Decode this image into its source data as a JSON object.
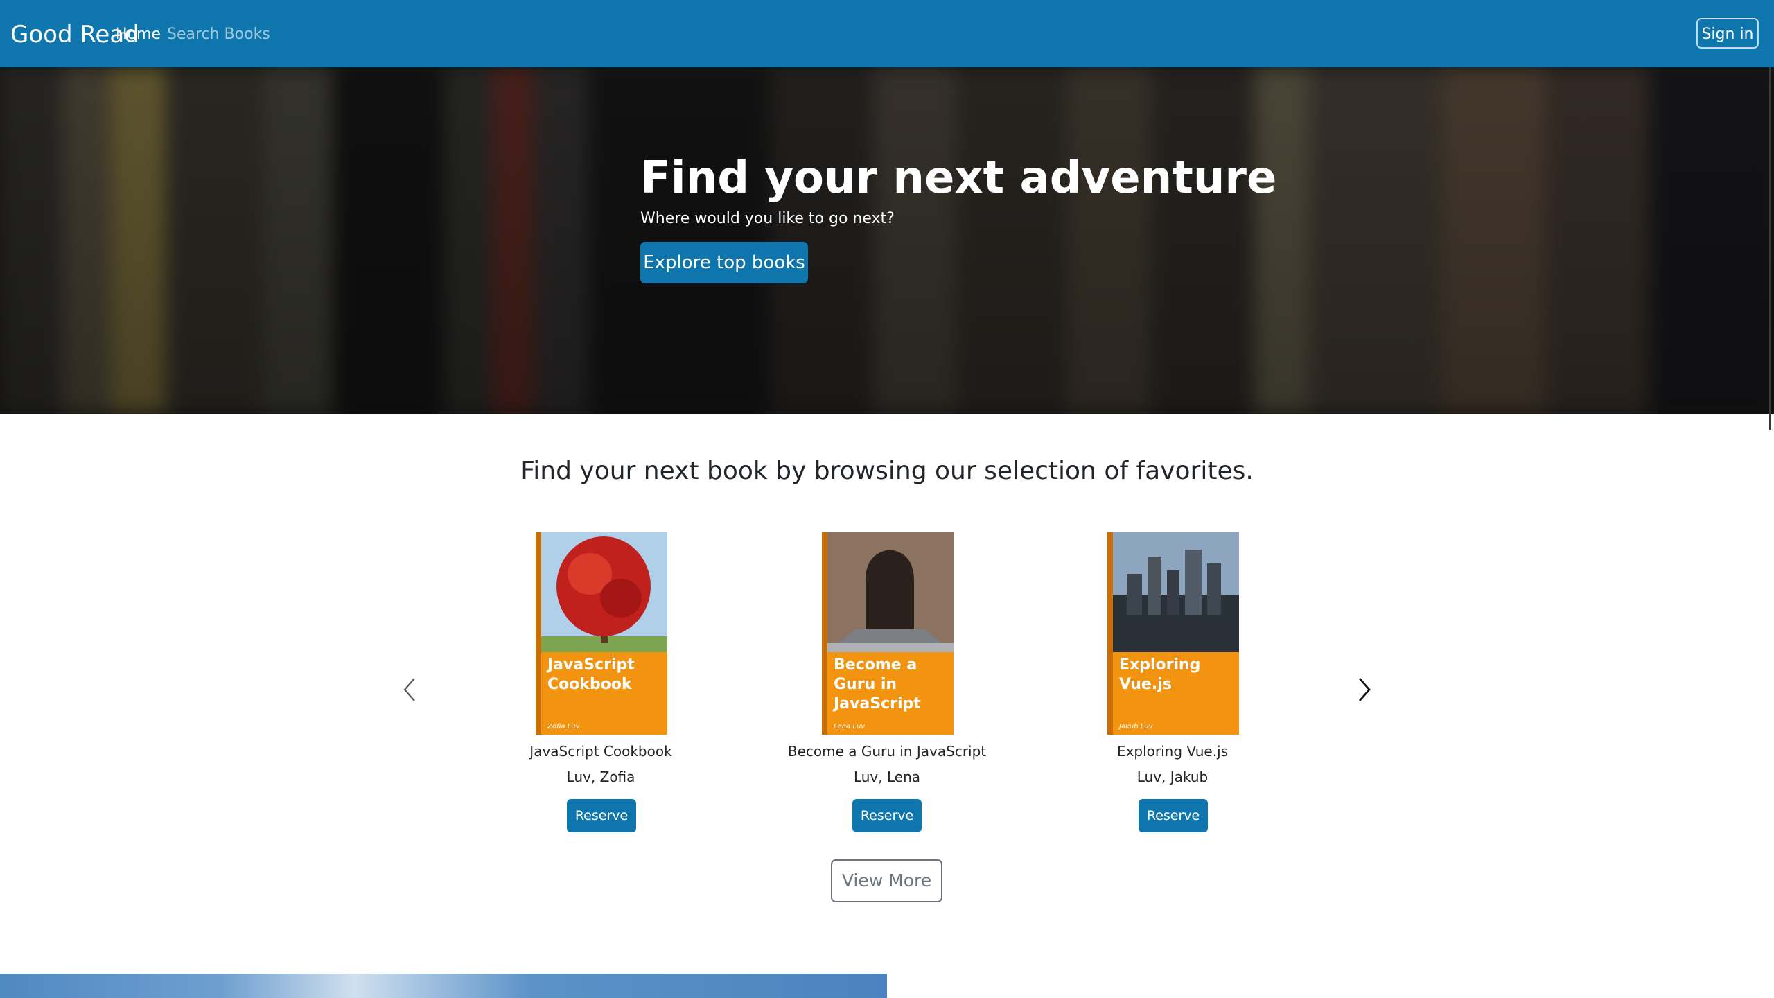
{
  "navbar": {
    "brand": "Good Read",
    "links": [
      {
        "label": "Home",
        "active": true
      },
      {
        "label": "Search Books",
        "active": false
      }
    ],
    "signin_label": "Sign in",
    "background": "#0f76ad"
  },
  "hero": {
    "title": "Find your next adventure",
    "subtitle": "Where would you like to go next?",
    "button_label": "Explore top books"
  },
  "carousel": {
    "heading": "Find your next book by browsing our selection of favorites.",
    "prev_icon": "chevron-left-icon",
    "next_icon": "chevron-right-icon",
    "books": [
      {
        "title": "JavaScript Cookbook",
        "author": "Luv, Zofia",
        "cover_title": "JavaScript Cookbook",
        "cover_author": "Zofia Luv",
        "button_label": "Reserve"
      },
      {
        "title": "Become a Guru in JavaScript",
        "author": "Luv, Lena",
        "cover_title": "Become a Guru in JavaScript",
        "cover_author": "Lena Luv",
        "button_label": "Reserve"
      },
      {
        "title": "Exploring Vue.js",
        "author": "Luv, Jakub",
        "cover_title": "Exploring Vue.js",
        "cover_author": "Jakub Luv",
        "button_label": "Reserve"
      }
    ],
    "view_more_label": "View More"
  },
  "colors": {
    "primary": "#0f76ad",
    "cover_orange": "#f39410"
  }
}
